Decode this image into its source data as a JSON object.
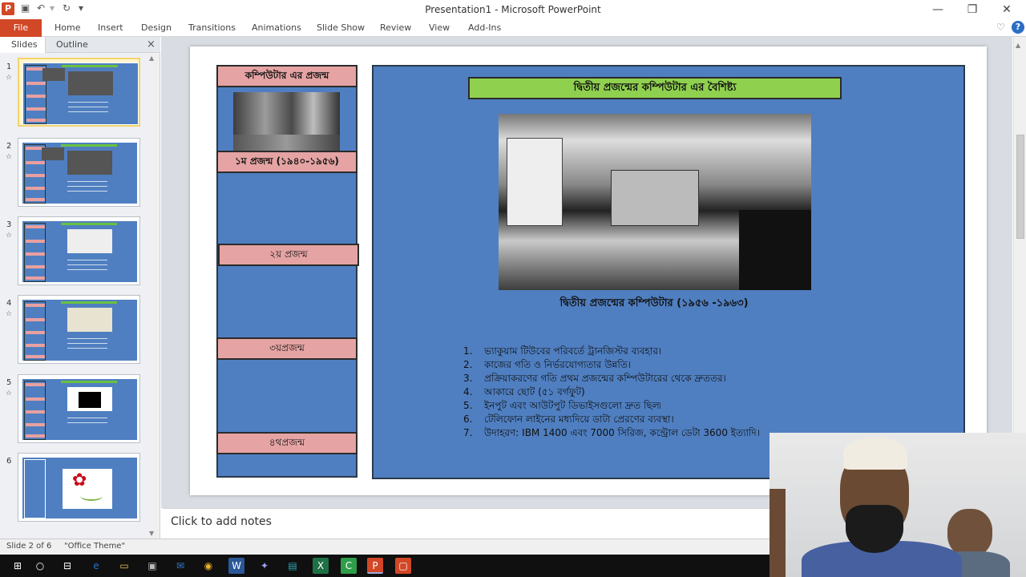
{
  "window": {
    "title": "Presentation1 - Microsoft PowerPoint",
    "app_icon": "P",
    "minimize": "—",
    "restore": "❐",
    "close": "✕",
    "quick_access": [
      "save-icon",
      "undo-icon",
      "redo-icon",
      "customize-icon"
    ]
  },
  "ribbon": {
    "file": "File",
    "tabs": [
      "Home",
      "Insert",
      "Design",
      "Transitions",
      "Animations",
      "Slide Show",
      "Review",
      "View",
      "Add-Ins"
    ],
    "collapse_icon": "♡",
    "help_icon": "?"
  },
  "panel": {
    "tabs": [
      "Slides",
      "Outline"
    ],
    "close": "×",
    "slides": [
      {
        "num": "1",
        "selected": true
      },
      {
        "num": "2"
      },
      {
        "num": "3"
      },
      {
        "num": "4"
      },
      {
        "num": "5"
      },
      {
        "num": "6"
      }
    ],
    "star": "☆"
  },
  "slide": {
    "left_labels": [
      "কম্পিউটার এর প্রজন্ম",
      "১ম প্রজন্ম (১৯৪০-১৯৫৬)",
      "২য় প্রজন্ম",
      "৩য়প্রজন্ম",
      "৪থপ্রজন্ম"
    ],
    "heading": "দ্বিতীয় প্রজন্মের কম্পিউটার এর বৈশিষ্ট্য",
    "caption": "দ্বিতীয় প্রজন্মের কম্পিউটার (১৯৫৬ -১৯৬৩)",
    "features": [
      {
        "n": "1.",
        "text": "ভ্যাকুয়াম টিউবের পরিবর্তে ট্রানজিস্টর ব্যবহার।"
      },
      {
        "n": "2.",
        "text": "কাজের গতি ও নির্ভরযোগ্যতার উন্নতি।"
      },
      {
        "n": "3.",
        "text": "প্রক্রিয়াকরণের গতি প্রথম প্রজন্মের কম্পিউটারের থেকে দ্রুততর।"
      },
      {
        "n": "4.",
        "text": "আকারে ছোট (৫১ বর্গফুট)"
      },
      {
        "n": "5.",
        "text": "ইনপুট এবং আউটপুট ডিভাইসগুলো দ্রুত ছিল৷"
      },
      {
        "n": "6.",
        "text": "টেলিফোন লাইনের মধ্যদিয়ে ডাটা প্রেরণের ব্যবস্থা।"
      },
      {
        "n": "7.",
        "text": "উদাহরণ: IBM 1400 এবং 7000 সিরিজ, কন্ট্রোল ডেটা 3600 ইত্যাদি।"
      }
    ]
  },
  "notes": {
    "placeholder": "Click to add notes"
  },
  "status": {
    "slide_info": "Slide 2 of 6",
    "theme": "\"Office Theme\""
  },
  "taskbar": {
    "start": "⊞",
    "search": "○",
    "taskview": "⊟",
    "apps": [
      {
        "icon": "e",
        "color": "#1e73d2"
      },
      {
        "icon": "▭",
        "color": "#f0c14b"
      },
      {
        "icon": "▣",
        "color": "#bbbbbb"
      },
      {
        "icon": "✉",
        "color": "#2e7bd8"
      },
      {
        "icon": "◉",
        "color": "#e8b12a"
      },
      {
        "icon": "W",
        "color": "#2b5797"
      },
      {
        "icon": "✦",
        "color": "#a0a0ff"
      },
      {
        "icon": "▤",
        "color": "#2fa8b8"
      },
      {
        "icon": "X",
        "color": "#1e7145"
      },
      {
        "icon": "C",
        "color": "#2e9e4a"
      },
      {
        "icon": "P",
        "color": "#d24726"
      },
      {
        "icon": "▢",
        "color": "#d24726"
      }
    ]
  }
}
